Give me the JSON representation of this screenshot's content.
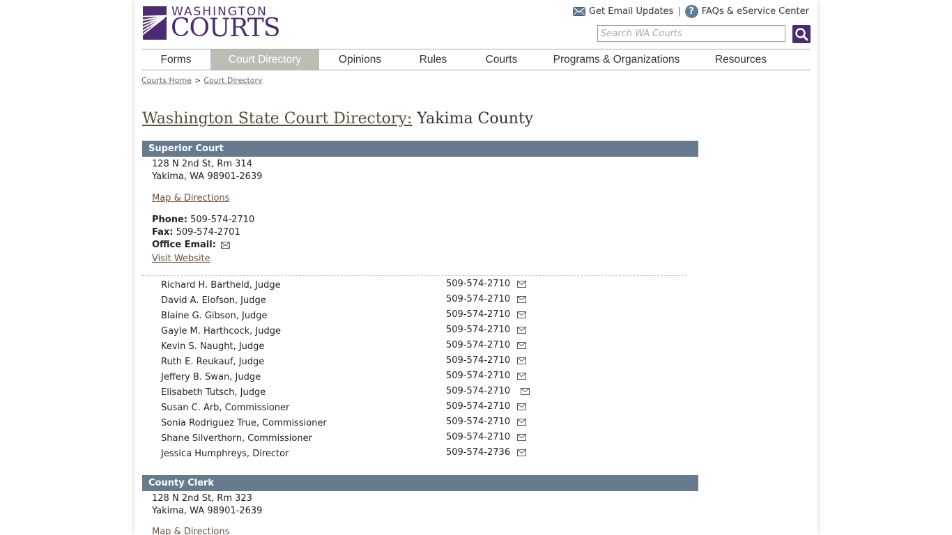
{
  "header": {
    "logo_line1": "WASHINGTON",
    "logo_line2": "COURTS",
    "email_updates": "Get Email Updates",
    "separator": "|",
    "faq": "FAQs & eService Center",
    "search_placeholder": "Search WA Courts"
  },
  "nav": [
    {
      "label": "Forms",
      "active": false
    },
    {
      "label": "Court Directory",
      "active": true
    },
    {
      "label": "Opinions",
      "active": false
    },
    {
      "label": "Rules",
      "active": false
    },
    {
      "label": "Courts",
      "active": false
    },
    {
      "label": "Programs & Organizations",
      "active": false
    },
    {
      "label": "Resources",
      "active": false
    }
  ],
  "breadcrumb": {
    "home": "Courts Home",
    "separator": ">",
    "current": "Court Directory"
  },
  "title": {
    "link": "Washington State Court Directory:",
    "rest": "Yakima County"
  },
  "superior": {
    "header": "Superior Court",
    "address1": "128 N 2nd St, Rm 314",
    "address2": "Yakima, WA 98901-2639",
    "map_link": "Map & Directions",
    "phone_label": "Phone:",
    "phone": "509-574-2710",
    "fax_label": "Fax:",
    "fax": "509-574-2701",
    "email_label": "Office Email:",
    "website_link": "Visit Website",
    "staff": [
      {
        "name": "Richard H. Bartheld, Judge",
        "phone": "509-574-2710"
      },
      {
        "name": "David A. Elofson, Judge",
        "phone": "509-574-2710"
      },
      {
        "name": "Blaine G. Gibson, Judge",
        "phone": "509-574-2710"
      },
      {
        "name": "Gayle M. Harthcock, Judge",
        "phone": "509-574-2710"
      },
      {
        "name": "Kevin S. Naught, Judge",
        "phone": "509-574-2710"
      },
      {
        "name": "Ruth E. Reukauf, Judge",
        "phone": "509-574-2710"
      },
      {
        "name": "Jeffery B. Swan, Judge",
        "phone": "509-574-2710"
      },
      {
        "name": "Elisabeth Tutsch, Judge",
        "phone": "509-574-2710"
      },
      {
        "name": "Susan C. Arb, Commissioner",
        "phone": "509-574-2710"
      },
      {
        "name": "Sonia Rodriguez True, Commissioner",
        "phone": "509-574-2710"
      },
      {
        "name": "Shane Silverthorn, Commissioner",
        "phone": "509-574-2710"
      },
      {
        "name": "Jessica Humphreys, Director",
        "phone": "509-574-2736"
      }
    ]
  },
  "clerk": {
    "header": "County Clerk",
    "address1": "128 N 2nd St, Rm 323",
    "address2": "Yakima, WA 98901-2639",
    "map_link": "Map & Directions"
  },
  "colors": {
    "brand_purple": "#4b2c70",
    "section_header": "#677b8f",
    "nav_active": "#bdbdb6",
    "link_brown": "#6a5036"
  },
  "icons": {
    "email": "envelope-icon",
    "faq": "question-circle-icon",
    "search": "magnifier-icon"
  }
}
